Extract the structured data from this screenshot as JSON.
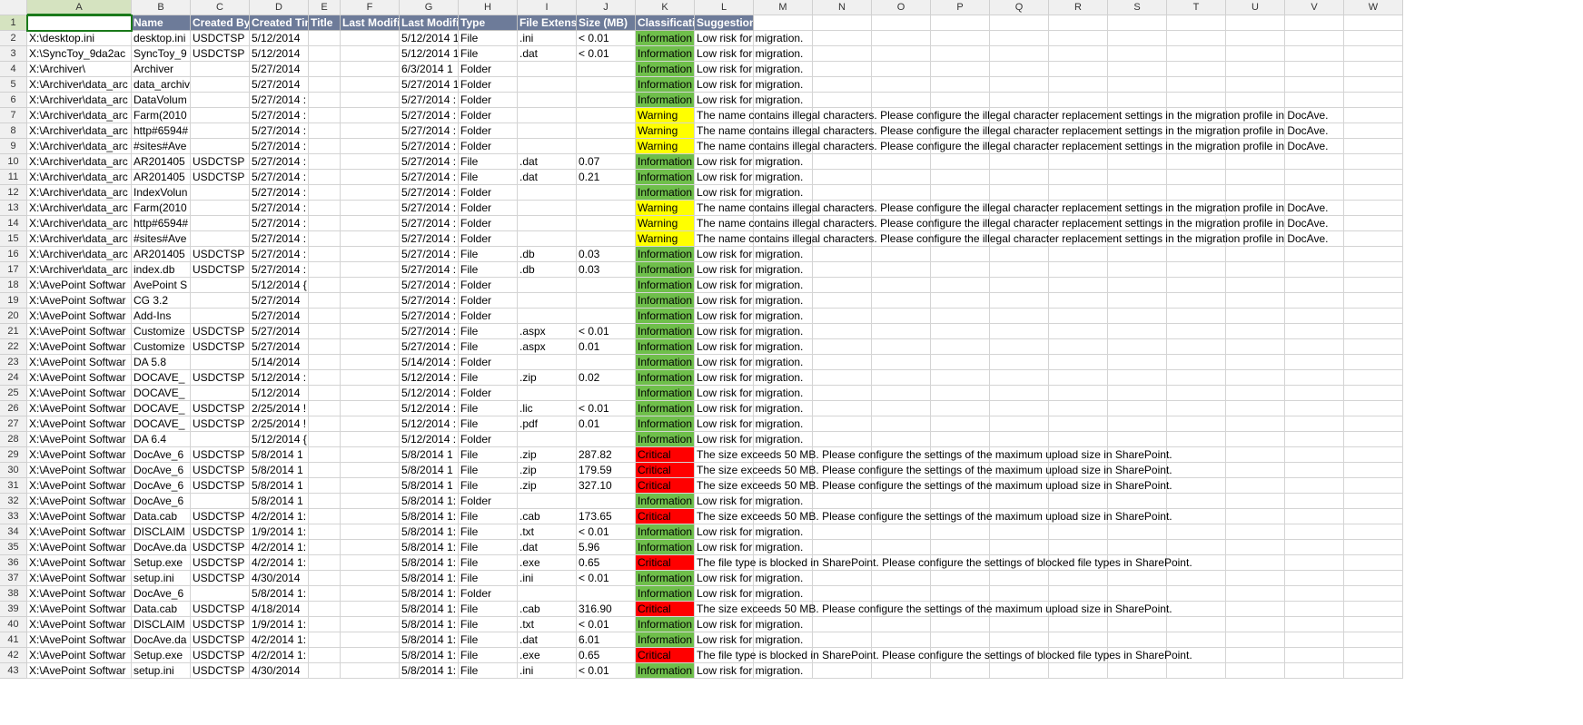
{
  "columns": [
    "A",
    "B",
    "C",
    "D",
    "E",
    "F",
    "G",
    "H",
    "I",
    "J",
    "K",
    "L",
    "M",
    "N",
    "O",
    "P",
    "Q",
    "R",
    "S",
    "T",
    "U",
    "V",
    "W"
  ],
  "headers": [
    "",
    "Name",
    "Created By",
    "Created Time",
    "Title",
    "Last Modified",
    "Last Modified",
    "Type",
    "File Extension",
    "Size (MB)",
    "Classification",
    "Suggestion"
  ],
  "classificationStyles": {
    "Information": "info",
    "Warning": "warn",
    "Critical": "crit"
  },
  "suggestions": {
    "low": "Low risk for migration.",
    "illegal": "The name contains illegal characters. Please configure the illegal character replacement settings in the migration profile in DocAve.",
    "size50": "The size exceeds 50 MB. Please configure the settings of the maximum upload size in SharePoint.",
    "blocked": "The file type is blocked in SharePoint. Please configure the settings of blocked file types in SharePoint."
  },
  "rows": [
    {
      "a": "X:\\desktop.ini",
      "b": "desktop.ini",
      "c": "USDCTSP",
      "d": "5/12/2014",
      "g": "5/12/2014 1",
      "h": "File",
      "i": ".ini",
      "j": "< 0.01",
      "k": "Information",
      "s": "low"
    },
    {
      "a": "X:\\SyncToy_9da2ac",
      "b": "SyncToy_9",
      "c": "USDCTSP",
      "d": "5/12/2014",
      "g": "5/12/2014 1",
      "h": "File",
      "i": ".dat",
      "j": "< 0.01",
      "k": "Information",
      "s": "low"
    },
    {
      "a": "X:\\Archiver\\",
      "b": "Archiver",
      "c": "",
      "d": "5/27/2014",
      "g": "6/3/2014 1",
      "h": "Folder",
      "i": "",
      "j": "",
      "k": "Information",
      "s": "low"
    },
    {
      "a": "X:\\Archiver\\data_arc",
      "b": "data_archiv",
      "c": "",
      "d": "5/27/2014",
      "g": "5/27/2014 1",
      "h": "Folder",
      "i": "",
      "j": "",
      "k": "Information",
      "s": "low"
    },
    {
      "a": "X:\\Archiver\\data_arc",
      "b": "DataVolum",
      "c": "",
      "d": "5/27/2014 :",
      "g": "5/27/2014 :",
      "h": "Folder",
      "i": "",
      "j": "",
      "k": "Information",
      "s": "low"
    },
    {
      "a": "X:\\Archiver\\data_arc",
      "b": "Farm(2010",
      "c": "",
      "d": "5/27/2014 :",
      "g": "5/27/2014 :",
      "h": "Folder",
      "i": "",
      "j": "",
      "k": "Warning",
      "s": "illegal"
    },
    {
      "a": "X:\\Archiver\\data_arc",
      "b": "http#6594#",
      "c": "",
      "d": "5/27/2014 :",
      "g": "5/27/2014 :",
      "h": "Folder",
      "i": "",
      "j": "",
      "k": "Warning",
      "s": "illegal"
    },
    {
      "a": "X:\\Archiver\\data_arc",
      "b": "#sites#Ave",
      "c": "",
      "d": "5/27/2014 :",
      "g": "5/27/2014 :",
      "h": "Folder",
      "i": "",
      "j": "",
      "k": "Warning",
      "s": "illegal"
    },
    {
      "a": "X:\\Archiver\\data_arc",
      "b": "AR201405",
      "c": "USDCTSP",
      "d": "5/27/2014 :",
      "g": "5/27/2014 :",
      "h": "File",
      "i": ".dat",
      "j": "0.07",
      "k": "Information",
      "s": "low"
    },
    {
      "a": "X:\\Archiver\\data_arc",
      "b": "AR201405",
      "c": "USDCTSP",
      "d": "5/27/2014 :",
      "g": "5/27/2014 :",
      "h": "File",
      "i": ".dat",
      "j": "0.21",
      "k": "Information",
      "s": "low"
    },
    {
      "a": "X:\\Archiver\\data_arc",
      "b": "IndexVolun",
      "c": "",
      "d": "5/27/2014 :",
      "g": "5/27/2014 :",
      "h": "Folder",
      "i": "",
      "j": "",
      "k": "Information",
      "s": "low"
    },
    {
      "a": "X:\\Archiver\\data_arc",
      "b": "Farm(2010",
      "c": "",
      "d": "5/27/2014 :",
      "g": "5/27/2014 :",
      "h": "Folder",
      "i": "",
      "j": "",
      "k": "Warning",
      "s": "illegal"
    },
    {
      "a": "X:\\Archiver\\data_arc",
      "b": "http#6594#",
      "c": "",
      "d": "5/27/2014 :",
      "g": "5/27/2014 :",
      "h": "Folder",
      "i": "",
      "j": "",
      "k": "Warning",
      "s": "illegal"
    },
    {
      "a": "X:\\Archiver\\data_arc",
      "b": "#sites#Ave",
      "c": "",
      "d": "5/27/2014 :",
      "g": "5/27/2014 :",
      "h": "Folder",
      "i": "",
      "j": "",
      "k": "Warning",
      "s": "illegal"
    },
    {
      "a": "X:\\Archiver\\data_arc",
      "b": "AR201405",
      "c": "USDCTSP",
      "d": "5/27/2014 :",
      "g": "5/27/2014 :",
      "h": "File",
      "i": ".db",
      "j": "0.03",
      "k": "Information",
      "s": "low"
    },
    {
      "a": "X:\\Archiver\\data_arc",
      "b": "index.db",
      "c": "USDCTSP",
      "d": "5/27/2014 :",
      "g": "5/27/2014 :",
      "h": "File",
      "i": ".db",
      "j": "0.03",
      "k": "Information",
      "s": "low"
    },
    {
      "a": "X:\\AvePoint Softwar",
      "b": "AvePoint S",
      "c": "",
      "d": "5/12/2014 {",
      "g": "5/27/2014 :",
      "h": "Folder",
      "i": "",
      "j": "",
      "k": "Information",
      "s": "low"
    },
    {
      "a": "X:\\AvePoint Softwar",
      "b": "CG 3.2",
      "c": "",
      "d": "5/27/2014",
      "g": "5/27/2014 :",
      "h": "Folder",
      "i": "",
      "j": "",
      "k": "Information",
      "s": "low"
    },
    {
      "a": "X:\\AvePoint Softwar",
      "b": "Add-Ins",
      "c": "",
      "d": "5/27/2014",
      "g": "5/27/2014 :",
      "h": "Folder",
      "i": "",
      "j": "",
      "k": "Information",
      "s": "low"
    },
    {
      "a": "X:\\AvePoint Softwar",
      "b": "Customize",
      "c": "USDCTSP",
      "d": "5/27/2014",
      "g": "5/27/2014 :",
      "h": "File",
      "i": ".aspx",
      "j": "< 0.01",
      "k": "Information",
      "s": "low"
    },
    {
      "a": "X:\\AvePoint Softwar",
      "b": "Customize",
      "c": "USDCTSP",
      "d": "5/27/2014",
      "g": "5/27/2014 :",
      "h": "File",
      "i": ".aspx",
      "j": "0.01",
      "k": "Information",
      "s": "low"
    },
    {
      "a": "X:\\AvePoint Softwar",
      "b": "DA 5.8",
      "c": "",
      "d": "5/14/2014",
      "g": "5/14/2014 :",
      "h": "Folder",
      "i": "",
      "j": "",
      "k": "Information",
      "s": "low"
    },
    {
      "a": "X:\\AvePoint Softwar",
      "b": "DOCAVE_",
      "c": "USDCTSP",
      "d": "5/12/2014 :",
      "g": "5/12/2014 :",
      "h": "File",
      "i": ".zip",
      "j": "0.02",
      "k": "Information",
      "s": "low"
    },
    {
      "a": "X:\\AvePoint Softwar",
      "b": "DOCAVE_",
      "c": "",
      "d": "5/12/2014",
      "g": "5/12/2014 :",
      "h": "Folder",
      "i": "",
      "j": "",
      "k": "Information",
      "s": "low"
    },
    {
      "a": "X:\\AvePoint Softwar",
      "b": "DOCAVE_",
      "c": "USDCTSP",
      "d": "2/25/2014 !",
      "g": "5/12/2014 :",
      "h": "File",
      "i": ".lic",
      "j": "< 0.01",
      "k": "Information",
      "s": "low"
    },
    {
      "a": "X:\\AvePoint Softwar",
      "b": "DOCAVE_",
      "c": "USDCTSP",
      "d": "2/25/2014 !",
      "g": "5/12/2014 :",
      "h": "File",
      "i": ".pdf",
      "j": "0.01",
      "k": "Information",
      "s": "low"
    },
    {
      "a": "X:\\AvePoint Softwar",
      "b": "DA 6.4",
      "c": "",
      "d": "5/12/2014 {",
      "g": "5/12/2014 :",
      "h": "Folder",
      "i": "",
      "j": "",
      "k": "Information",
      "s": "low"
    },
    {
      "a": "X:\\AvePoint Softwar",
      "b": "DocAve_6",
      "c": "USDCTSP",
      "d": "5/8/2014 1",
      "g": "5/8/2014 1",
      "h": "File",
      "i": ".zip",
      "j": "287.82",
      "k": "Critical",
      "s": "size50"
    },
    {
      "a": "X:\\AvePoint Softwar",
      "b": "DocAve_6",
      "c": "USDCTSP",
      "d": "5/8/2014 1",
      "g": "5/8/2014 1",
      "h": "File",
      "i": ".zip",
      "j": "179.59",
      "k": "Critical",
      "s": "size50"
    },
    {
      "a": "X:\\AvePoint Softwar",
      "b": "DocAve_6",
      "c": "USDCTSP",
      "d": "5/8/2014 1",
      "g": "5/8/2014 1",
      "h": "File",
      "i": ".zip",
      "j": "327.10",
      "k": "Critical",
      "s": "size50"
    },
    {
      "a": "X:\\AvePoint Softwar",
      "b": "DocAve_6",
      "c": "",
      "d": "5/8/2014 1",
      "g": "5/8/2014 1:",
      "h": "Folder",
      "i": "",
      "j": "",
      "k": "Information",
      "s": "low"
    },
    {
      "a": "X:\\AvePoint Softwar",
      "b": "Data.cab",
      "c": "USDCTSP",
      "d": "4/2/2014 1:",
      "g": "5/8/2014 1:",
      "h": "File",
      "i": ".cab",
      "j": "173.65",
      "k": "Critical",
      "s": "size50"
    },
    {
      "a": "X:\\AvePoint Softwar",
      "b": "DISCLAIM",
      "c": "USDCTSP",
      "d": "1/9/2014 1:",
      "g": "5/8/2014 1:",
      "h": "File",
      "i": ".txt",
      "j": "< 0.01",
      "k": "Information",
      "s": "low"
    },
    {
      "a": "X:\\AvePoint Softwar",
      "b": "DocAve.da",
      "c": "USDCTSP",
      "d": "4/2/2014 1:",
      "g": "5/8/2014 1:",
      "h": "File",
      "i": ".dat",
      "j": "5.96",
      "k": "Information",
      "s": "low"
    },
    {
      "a": "X:\\AvePoint Softwar",
      "b": "Setup.exe",
      "c": "USDCTSP",
      "d": "4/2/2014 1:",
      "g": "5/8/2014 1:",
      "h": "File",
      "i": ".exe",
      "j": "0.65",
      "k": "Critical",
      "s": "blocked"
    },
    {
      "a": "X:\\AvePoint Softwar",
      "b": "setup.ini",
      "c": "USDCTSP",
      "d": "4/30/2014",
      "g": "5/8/2014 1:",
      "h": "File",
      "i": ".ini",
      "j": "< 0.01",
      "k": "Information",
      "s": "low"
    },
    {
      "a": "X:\\AvePoint Softwar",
      "b": "DocAve_6",
      "c": "",
      "d": "5/8/2014 1:",
      "g": "5/8/2014 1:",
      "h": "Folder",
      "i": "",
      "j": "",
      "k": "Information",
      "s": "low"
    },
    {
      "a": "X:\\AvePoint Softwar",
      "b": "Data.cab",
      "c": "USDCTSP",
      "d": "4/18/2014",
      "g": "5/8/2014 1:",
      "h": "File",
      "i": ".cab",
      "j": "316.90",
      "k": "Critical",
      "s": "size50"
    },
    {
      "a": "X:\\AvePoint Softwar",
      "b": "DISCLAIM",
      "c": "USDCTSP",
      "d": "1/9/2014 1:",
      "g": "5/8/2014 1:",
      "h": "File",
      "i": ".txt",
      "j": "< 0.01",
      "k": "Information",
      "s": "low"
    },
    {
      "a": "X:\\AvePoint Softwar",
      "b": "DocAve.da",
      "c": "USDCTSP",
      "d": "4/2/2014 1:",
      "g": "5/8/2014 1:",
      "h": "File",
      "i": ".dat",
      "j": "6.01",
      "k": "Information",
      "s": "low"
    },
    {
      "a": "X:\\AvePoint Softwar",
      "b": "Setup.exe",
      "c": "USDCTSP",
      "d": "4/2/2014 1:",
      "g": "5/8/2014 1:",
      "h": "File",
      "i": ".exe",
      "j": "0.65",
      "k": "Critical",
      "s": "blocked"
    },
    {
      "a": "X:\\AvePoint Softwar",
      "b": "setup.ini",
      "c": "USDCTSP",
      "d": "4/30/2014",
      "g": "5/8/2014 1:",
      "h": "File",
      "i": ".ini",
      "j": "< 0.01",
      "k": "Information",
      "s": "low"
    }
  ]
}
